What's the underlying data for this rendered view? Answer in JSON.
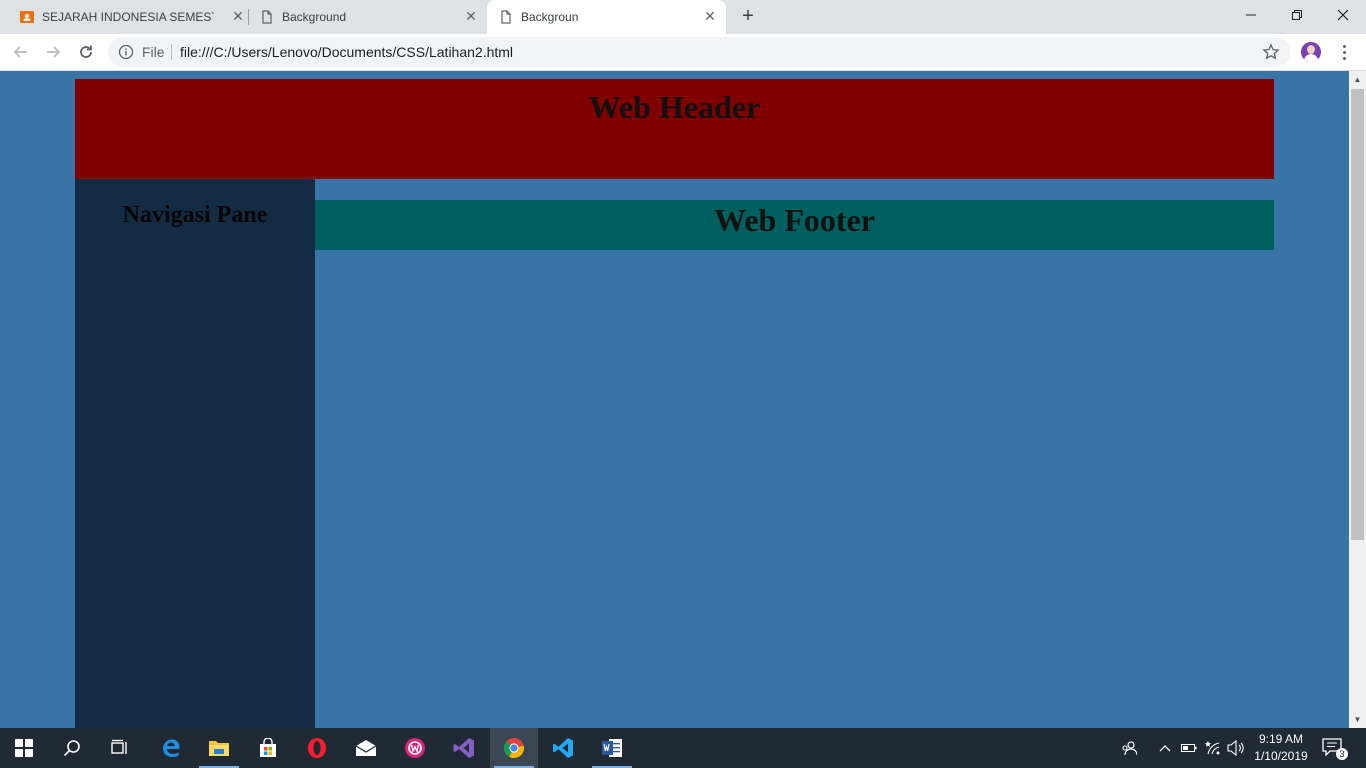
{
  "browser": {
    "tabs": [
      {
        "title": "SEJARAH INDONESIA SEMESTER",
        "icon": "classroom-icon",
        "active": false
      },
      {
        "title": "Background",
        "icon": "page-icon",
        "active": false
      },
      {
        "title": "Backgroun",
        "icon": "page-icon",
        "active": true
      }
    ],
    "new_tab_label": "+",
    "address": {
      "scheme_label": "File",
      "url": "file:///C:/Users/Lenovo/Documents/CSS/Latihan2.html"
    }
  },
  "page": {
    "header_text": "Web Header",
    "nav_text": "Navigasi Pane",
    "footer_text": "Web Footer",
    "colors": {
      "background": "#3874a5",
      "header": "#800000",
      "nav": "#142b44",
      "footer": "#006060"
    }
  },
  "taskbar": {
    "apps": [
      "start-icon",
      "search-icon",
      "task-view-icon",
      "edge-icon",
      "file-explorer-icon",
      "store-icon",
      "opera-icon",
      "mail-icon",
      "wamp-icon",
      "visual-studio-icon",
      "chrome-icon",
      "vscode-icon",
      "word-icon"
    ],
    "active_app": "chrome-icon",
    "time": "9:19 AM",
    "date": "1/10/2019",
    "notification_count": "3"
  }
}
